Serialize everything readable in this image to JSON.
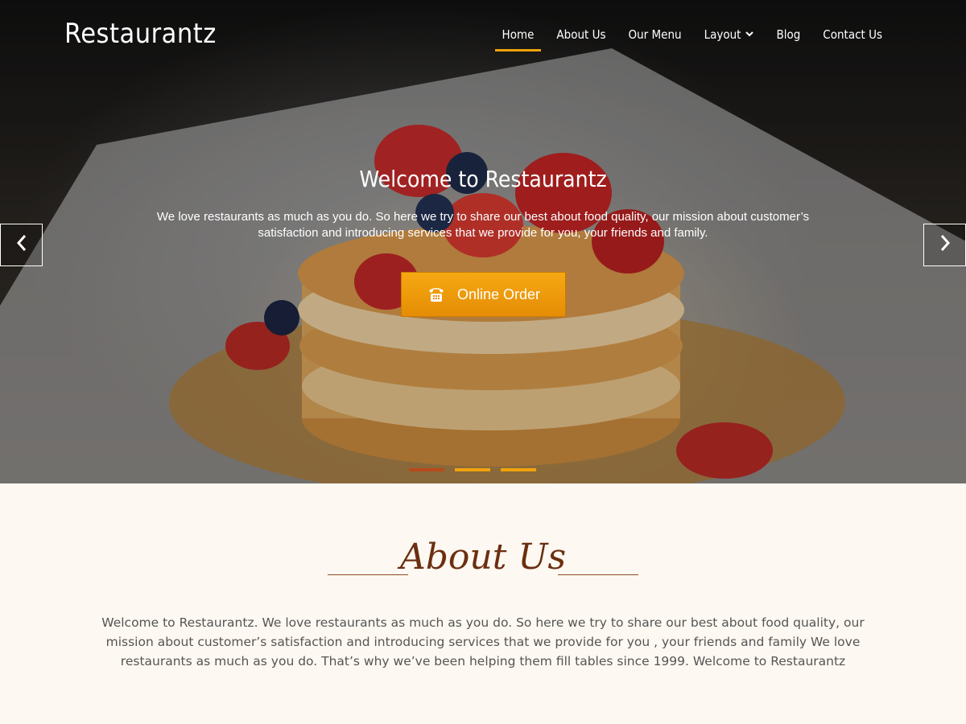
{
  "header": {
    "site_title": "Restaurantz",
    "nav": [
      {
        "label": "Home",
        "active": true
      },
      {
        "label": "About Us"
      },
      {
        "label": "Our Menu"
      },
      {
        "label": "Layout",
        "has_dropdown": true
      },
      {
        "label": "Blog"
      },
      {
        "label": "Contact Us"
      }
    ]
  },
  "hero": {
    "title": "Welcome to Restaurantz",
    "text": "We love restaurants as much as you do. So here we try to share our best about food quality, our mission about customer’s satisfaction and introducing services that we provide for you, your friends and family.",
    "button_label": "Online Order",
    "button_icon": "phone-icon",
    "slides": 3,
    "active_slide": 1
  },
  "about": {
    "heading": "About Us",
    "text": "Welcome to Restaurantz. We love restaurants as much as you do. So here we try to share our best about food quality, our mission about customer’s satisfaction and introducing services that we provide for you , your friends and family We love restaurants as much as you do. That’s why we’ve been helping them fill tables since 1999. Welcome to Restaurantz"
  },
  "colors": {
    "accent": "#f1a30a",
    "active_dot": "#b84a1a",
    "about_heading": "#6b2f10",
    "page_bg": "#fdf8f1"
  }
}
